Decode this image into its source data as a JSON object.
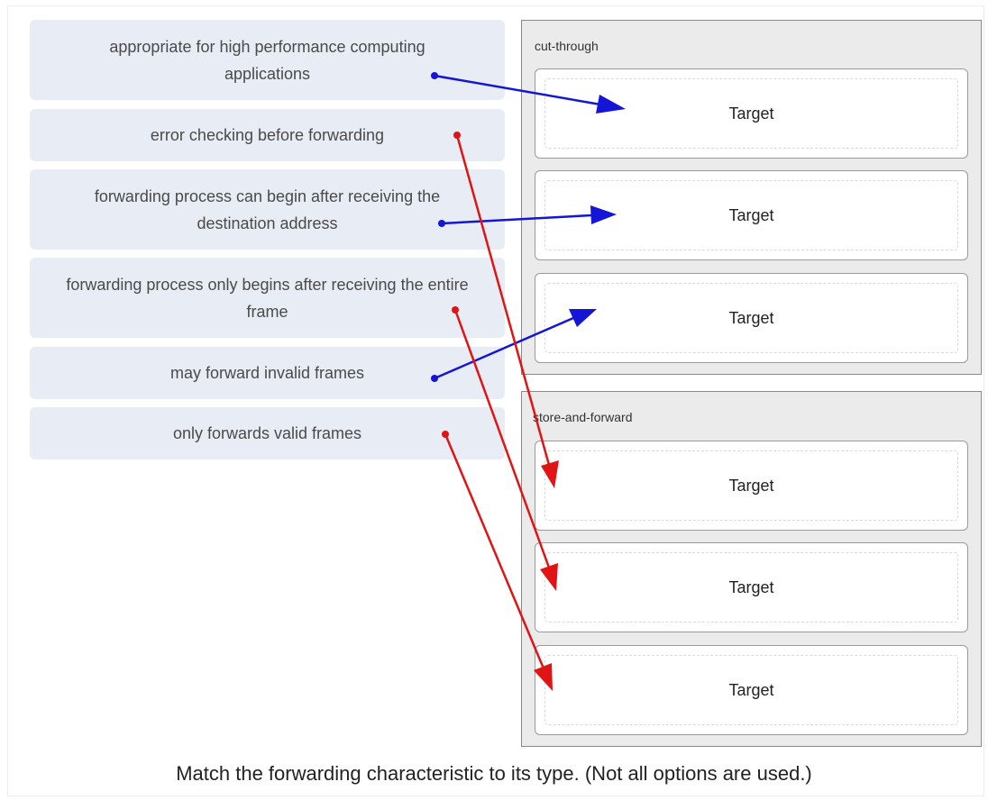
{
  "options": [
    {
      "label": "appropriate for high performance computing applications"
    },
    {
      "label": "error checking before forwarding"
    },
    {
      "label": "forwarding process can begin after receiving the destination address"
    },
    {
      "label": "forwarding process only begins after receiving the entire frame"
    },
    {
      "label": "may forward invalid frames"
    },
    {
      "label": "only forwards valid frames"
    }
  ],
  "groups": [
    {
      "label": "cut-through",
      "targets": [
        "Target",
        "Target",
        "Target"
      ]
    },
    {
      "label": "store-and-forward",
      "targets": [
        "Target",
        "Target",
        "Target"
      ]
    }
  ],
  "caption": "Match the forwarding characteristic to its type. (Not all options are used.)",
  "colors": {
    "cut_through_arrow": "#1515d6",
    "store_forward_arrow": "#e01414",
    "option_bg": "#e8edf5",
    "group_bg": "#ebebeb"
  }
}
